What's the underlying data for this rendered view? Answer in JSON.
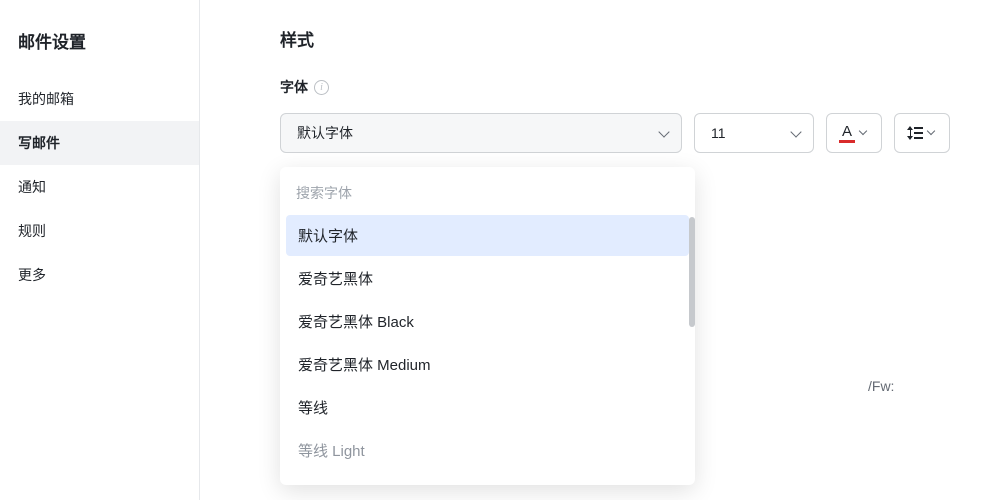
{
  "sidebar": {
    "title": "邮件设置",
    "items": [
      {
        "label": "我的邮箱"
      },
      {
        "label": "写邮件"
      },
      {
        "label": "通知"
      },
      {
        "label": "规则"
      },
      {
        "label": "更多"
      }
    ]
  },
  "main": {
    "section_title": "样式",
    "font_label": "字体",
    "font_select_value": "默认字体",
    "size_select_value": "11",
    "text_color_letter": "A",
    "text_underline_color": "#d92b2b",
    "dropdown": {
      "search_placeholder": "搜索字体",
      "options": [
        {
          "label": "默认字体",
          "selected": true
        },
        {
          "label": "爱奇艺黑体"
        },
        {
          "label": "爱奇艺黑体 Black"
        },
        {
          "label": "爱奇艺黑体 Medium"
        },
        {
          "label": "等线"
        },
        {
          "label": "等线 Light",
          "muted": true
        }
      ]
    },
    "bg_fragment_1": "/Fw:"
  }
}
